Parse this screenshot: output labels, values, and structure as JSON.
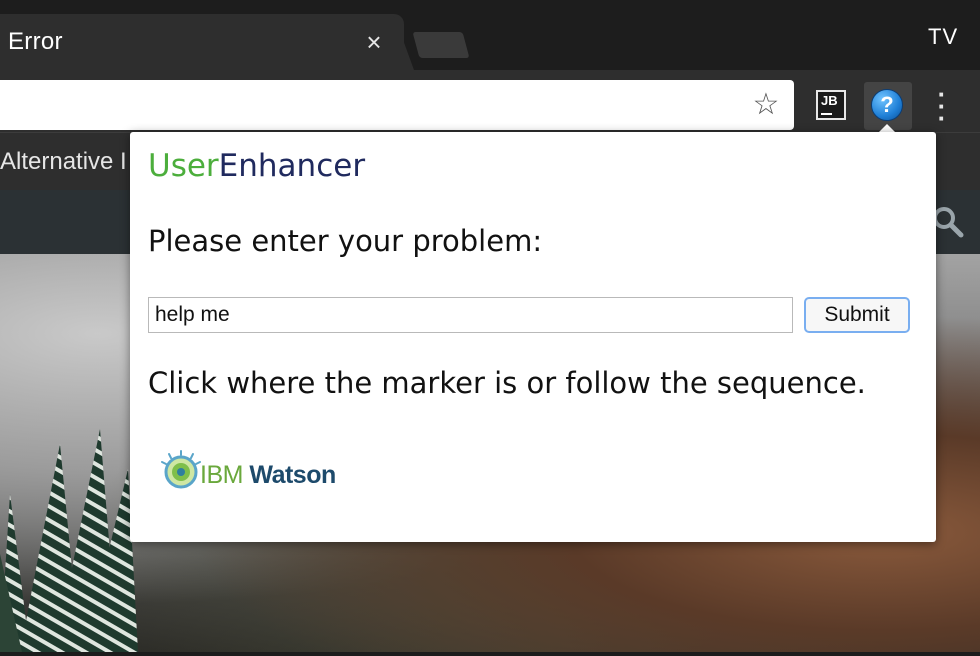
{
  "browser": {
    "tab_title": "Error",
    "tab_close_glyph": "×",
    "profile_label": "TV",
    "bookmark_text": "Alternative I",
    "icons": {
      "star": "star-icon",
      "jb": "jetbrains-extension-icon",
      "help": "help-extension-icon",
      "menu": "kebab-menu-icon",
      "search": "search-icon"
    }
  },
  "extension": {
    "jb_label": "JB",
    "help_glyph": "?"
  },
  "popup": {
    "brand_user": "User",
    "brand_enhancer": "Enhancer",
    "prompt": "Please enter your problem:",
    "input_value": "help me",
    "submit_label": "Submit",
    "instruction": "Click where the marker is or follow the sequence.",
    "logo_ibm": "IBM",
    "logo_watson": "Watson",
    "colors": {
      "brand_user": "#4cae3c",
      "brand_enhancer": "#202a5e",
      "submit_border": "#79aef0"
    }
  }
}
